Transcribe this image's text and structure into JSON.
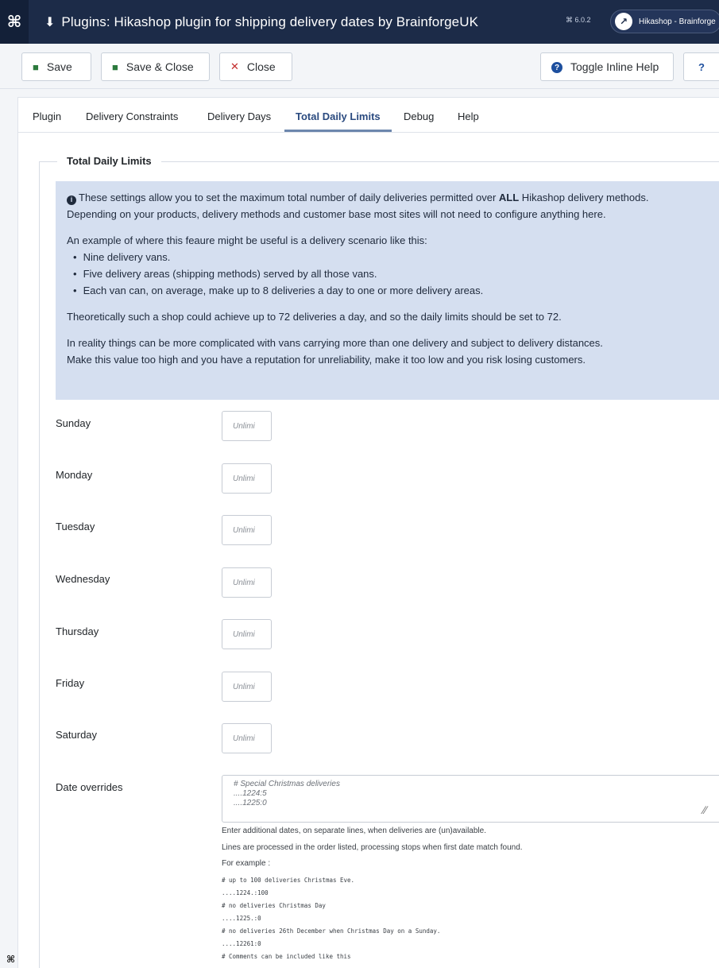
{
  "header": {
    "logo": "joomla-logo-icon",
    "plug_icon": "plug-icon",
    "title": "Plugins: Hikashop plugin for shipping delivery dates by BrainforgeUK",
    "version": "⌘ 6.0.2",
    "site_button": "Hikashop - Brainforge"
  },
  "toolbar": {
    "save": "Save",
    "save_close": "Save & Close",
    "close": "Close",
    "toggle_help": "Toggle Inline Help",
    "help": "?"
  },
  "tabs": [
    {
      "label": "Plugin"
    },
    {
      "label": "Delivery Constraints"
    },
    {
      "label": "Delivery Days"
    },
    {
      "label": "Total Daily Limits",
      "active": true
    },
    {
      "label": "Debug"
    },
    {
      "label": "Help"
    }
  ],
  "fieldset": {
    "legend": "Total Daily Limits"
  },
  "info": {
    "line1a": "These settings allow you to set the maximum total number of daily deliveries permitted over ",
    "line1b": "ALL",
    "line1c": " Hikashop delivery methods.",
    "line2": "Depending on your products, delivery methods and customer base most sites will not need to configure anything here.",
    "line3": "An example of where this feaure might be useful is a delivery scenario like this:",
    "bullets": [
      "Nine delivery vans.",
      "Five delivery areas (shipping methods) served by all those vans.",
      "Each van can, on average, make up to 8 deliveries a day to one or more delivery areas."
    ],
    "line4": "Theoretically such a shop could achieve up to 72 deliveries a day, and so the daily limits should be set to 72.",
    "line5": "In reality things can be more complicated with vans carrying more than one delivery and subject to delivery distances.",
    "line6": "Make this value too high and you have a reputation for unreliability, make it too low and you risk losing customers."
  },
  "days": [
    {
      "label": "Sunday",
      "placeholder": "Unlimi"
    },
    {
      "label": "Monday",
      "placeholder": "Unlimi"
    },
    {
      "label": "Tuesday",
      "placeholder": "Unlimi"
    },
    {
      "label": "Wednesday",
      "placeholder": "Unlimi"
    },
    {
      "label": "Thursday",
      "placeholder": "Unlimi"
    },
    {
      "label": "Friday",
      "placeholder": "Unlimi"
    },
    {
      "label": "Saturday",
      "placeholder": "Unlimi"
    }
  ],
  "overrides": {
    "label": "Date overrides",
    "placeholder": "# Special Christmas deliveries\n....1224:5\n....1225:0",
    "help1": "Enter additional dates, on separate lines, when deliveries are (un)available.",
    "help2": "Lines are processed in the order listed, processing stops when first date match found.",
    "help3": "For example :",
    "examples": [
      "# up to 100 deliveries Christmas Eve.",
      "....1224.:100",
      "# no deliveries Christmas Day",
      "....1225.:0",
      "# no deliveries 26th December when Christmas Day on a Sunday.",
      "....12261:0",
      "# Comments can be included like this"
    ]
  }
}
